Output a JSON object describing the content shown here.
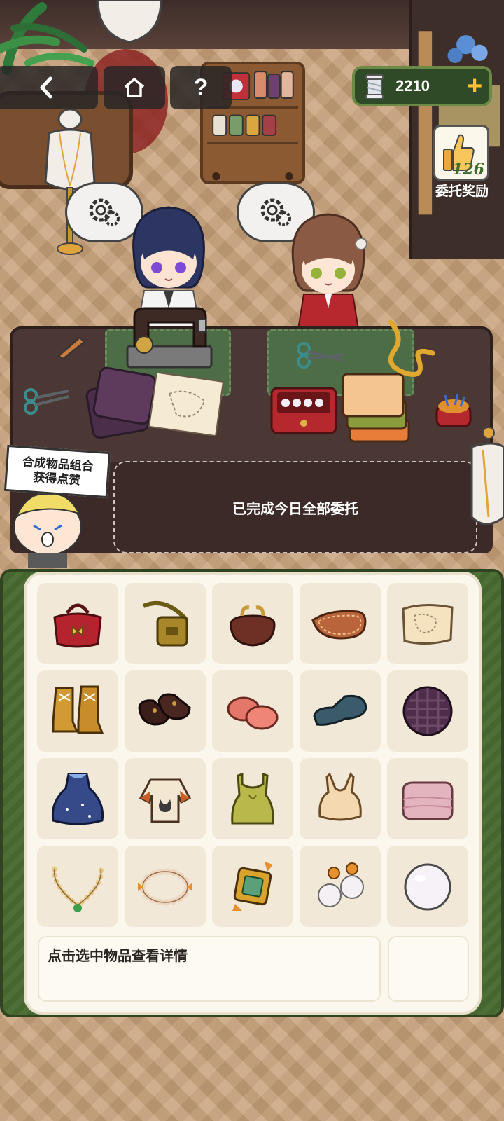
{
  "hud": {
    "back_icon": "chevron-left-icon",
    "home_icon": "home-icon",
    "help_label": "?",
    "currency_amount": "2210",
    "currency_plus": "+",
    "currency_icon": "thread-spool-icon"
  },
  "reward": {
    "count": "126",
    "label": "委托奖励",
    "icon": "thumbs-up-icon"
  },
  "bench": {
    "status_text": "已完成今日全部委托"
  },
  "sign": {
    "line1": "合成物品组合",
    "line2": "获得点赞"
  },
  "inventory": {
    "items": [
      {
        "name": "red-handbag",
        "icon": "red-handbag-icon"
      },
      {
        "name": "olive-crossbody-bag",
        "icon": "crossbody-bag-icon"
      },
      {
        "name": "brown-coin-purse",
        "icon": "coin-purse-icon"
      },
      {
        "name": "leather-piece",
        "icon": "leather-piece-icon"
      },
      {
        "name": "sewing-pattern-paper",
        "icon": "pattern-paper-icon"
      },
      {
        "name": "lace-up-boots",
        "icon": "boots-icon"
      },
      {
        "name": "black-mary-janes",
        "icon": "mary-jane-shoes-icon"
      },
      {
        "name": "pink-fluffy-slippers",
        "icon": "slippers-icon"
      },
      {
        "name": "teal-loafer",
        "icon": "loafer-icon"
      },
      {
        "name": "purple-woven-fabric",
        "icon": "fabric-swatch-icon"
      },
      {
        "name": "blue-starry-dress",
        "icon": "dress-icon"
      },
      {
        "name": "cat-sweater",
        "icon": "cat-sweater-icon"
      },
      {
        "name": "olive-tank-top",
        "icon": "tank-top-icon"
      },
      {
        "name": "cream-bodice",
        "icon": "bodice-icon"
      },
      {
        "name": "pink-folded-towel",
        "icon": "folded-cloth-icon"
      },
      {
        "name": "clover-pearl-necklace",
        "icon": "necklace-icon"
      },
      {
        "name": "beaded-bracelet",
        "icon": "bracelet-icon"
      },
      {
        "name": "emerald-brooch",
        "icon": "brooch-icon"
      },
      {
        "name": "pearl-earrings",
        "icon": "earrings-icon"
      },
      {
        "name": "white-pearl",
        "icon": "pearl-icon"
      }
    ],
    "detail_hint": "点击选中物品查看详情"
  }
}
